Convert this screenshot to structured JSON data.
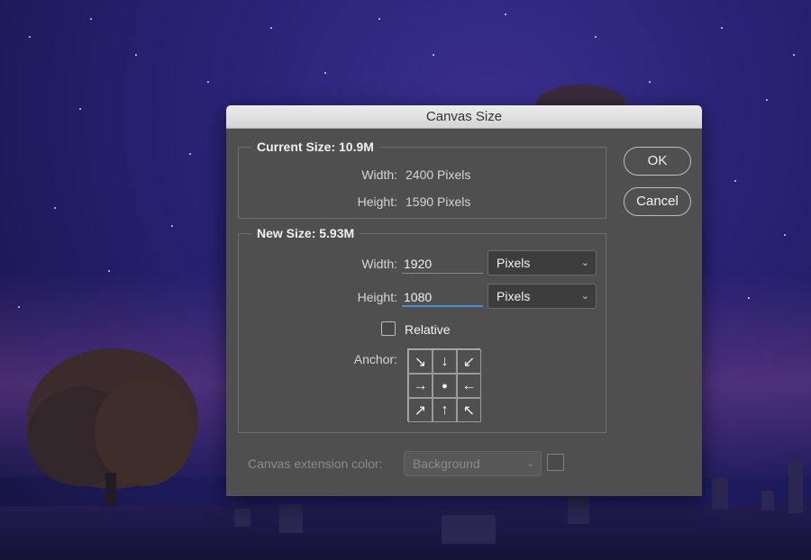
{
  "dialog": {
    "title": "Canvas Size",
    "current_size": {
      "legend": "Current Size: 10.9M",
      "width_label": "Width:",
      "width_value": "2400 Pixels",
      "height_label": "Height:",
      "height_value": "1590 Pixels"
    },
    "new_size": {
      "legend": "New Size: 5.93M",
      "width_label": "Width:",
      "width_value": "1920",
      "width_unit": "Pixels",
      "height_label": "Height:",
      "height_value": "1080",
      "height_unit": "Pixels",
      "relative_label": "Relative",
      "relative_checked": false,
      "anchor_label": "Anchor:",
      "anchor_arrows": [
        "↘",
        "↓",
        "↙",
        "→",
        "●",
        "←",
        "↗",
        "↑",
        "↖"
      ]
    },
    "extension": {
      "label": "Canvas extension color:",
      "value": "Background"
    },
    "buttons": {
      "ok": "OK",
      "cancel": "Cancel"
    }
  },
  "colors": {
    "dialog_bg": "#4f4f4f",
    "titlebar_bg": "#dcdcdc",
    "focus_accent": "#4a8fd8"
  }
}
